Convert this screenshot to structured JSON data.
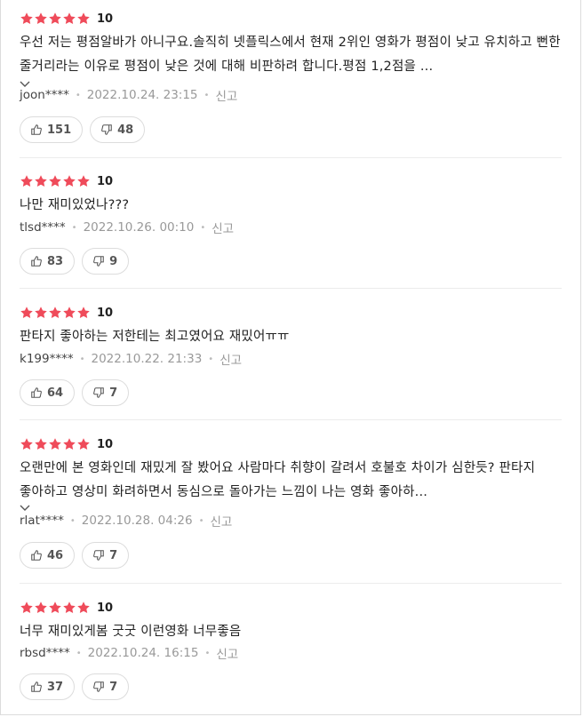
{
  "colors": {
    "star": "#ef4b5a",
    "text": "#222222",
    "meta": "#999999",
    "border": "#dcdcdc"
  },
  "reviews": [
    {
      "stars": 5,
      "score": "10",
      "content": "우선 저는 평점알바가 아니구요.솔직히 넷플릭스에서 현재 2위인 영화가 평점이 낮고 유치하고 뻔한 줄거리라는 이유로 평점이 낮은 것에 대해 비판하려 합니다.평점 1,2점을 ...",
      "expandable": true,
      "user": "joon****",
      "date": "2022.10.24. 23:15",
      "report": "신고",
      "likes": "151",
      "dislikes": "48"
    },
    {
      "stars": 5,
      "score": "10",
      "content": "나만 재미있었나???",
      "expandable": false,
      "user": "tlsd****",
      "date": "2022.10.26. 00:10",
      "report": "신고",
      "likes": "83",
      "dislikes": "9"
    },
    {
      "stars": 5,
      "score": "10",
      "content": "판타지 좋아하는 저한테는 최고였어요 재밌어ㅠㅠ",
      "expandable": false,
      "user": "k199****",
      "date": "2022.10.22. 21:33",
      "report": "신고",
      "likes": "64",
      "dislikes": "7"
    },
    {
      "stars": 5,
      "score": "10",
      "content": "오랜만에 본 영화인데 재밌게 잘 봤어요 사람마다 취향이 갈려서 호불호 차이가 심한듯? 판타지 좋아하고 영상미 화려하면서 동심으로 돌아가는 느낌이 나는 영화 좋아하...",
      "expandable": true,
      "user": "rlat****",
      "date": "2022.10.28. 04:26",
      "report": "신고",
      "likes": "46",
      "dislikes": "7"
    },
    {
      "stars": 5,
      "score": "10",
      "content": "너무 재미있게봄 굿굿 이런영화 너무좋음",
      "expandable": false,
      "user": "rbsd****",
      "date": "2022.10.24. 16:15",
      "report": "신고",
      "likes": "37",
      "dislikes": "7"
    }
  ]
}
